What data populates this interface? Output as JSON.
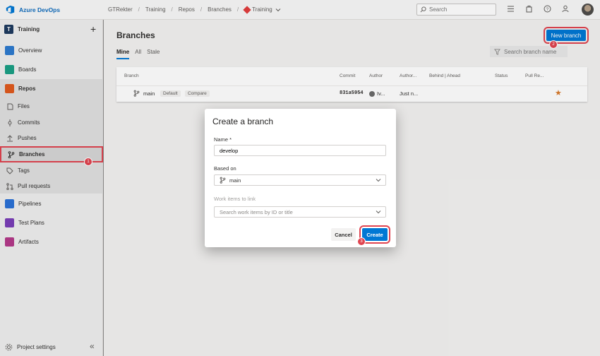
{
  "topbar": {
    "brand": "Azure DevOps",
    "breadcrumbs": [
      "GTRekter",
      "Training",
      "Repos",
      "Branches",
      "Training"
    ],
    "search_placeholder": "Search"
  },
  "sidebar": {
    "project_badge": "T",
    "project": "Training",
    "items": [
      {
        "label": "Overview",
        "icon": "overview-icon",
        "color": "#2e7bcf"
      },
      {
        "label": "Boards",
        "icon": "boards-icon",
        "color": "#1ba085"
      },
      {
        "label": "Repos",
        "icon": "repos-icon",
        "color": "#e05a1e"
      },
      {
        "label": "Files",
        "icon": "files-icon"
      },
      {
        "label": "Commits",
        "icon": "commits-icon"
      },
      {
        "label": "Pushes",
        "icon": "pushes-icon"
      },
      {
        "label": "Branches",
        "icon": "branches-icon"
      },
      {
        "label": "Tags",
        "icon": "tags-icon"
      },
      {
        "label": "Pull requests",
        "icon": "pull-requests-icon"
      },
      {
        "label": "Pipelines",
        "icon": "pipelines-icon",
        "color": "#2b71d6"
      },
      {
        "label": "Test Plans",
        "icon": "test-plans-icon",
        "color": "#7a3fb8"
      },
      {
        "label": "Artifacts",
        "icon": "artifacts-icon",
        "color": "#b4398a"
      }
    ],
    "settings": "Project settings"
  },
  "main": {
    "title": "Branches",
    "new_branch": "New branch",
    "pivots": [
      "Mine",
      "All",
      "Stale"
    ],
    "filter_placeholder": "Search branch name",
    "columns": [
      "Branch",
      "Commit",
      "Author",
      "Author...",
      "Behind | Ahead",
      "Status",
      "Pull Re..."
    ],
    "row": {
      "name": "main",
      "tags": [
        "Default",
        "Compare"
      ],
      "commit": "831a5954",
      "author": "Iv...",
      "authored": "Just n..."
    }
  },
  "steps": [
    "1",
    "2",
    "3"
  ],
  "dialog": {
    "title": "Create a branch",
    "name_label": "Name *",
    "name_value": "develop",
    "based_on_label": "Based on",
    "based_on_value": "main",
    "work_items_label": "Work items to link",
    "work_items_placeholder": "Search work items by ID or title",
    "cancel": "Cancel",
    "create": "Create"
  }
}
